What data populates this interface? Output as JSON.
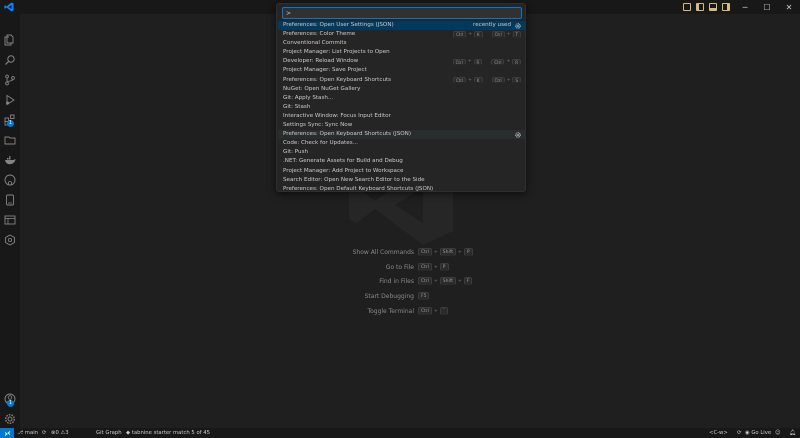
{
  "titlebar": {
    "minimize": "─",
    "maximize": "☐",
    "close": "✕"
  },
  "quickpick": {
    "input_value": ">",
    "items": [
      {
        "label": "Preferences: Open User Settings (JSON)",
        "tag": "recently used",
        "gear": true,
        "state": "active"
      },
      {
        "label": "Preferences: Color Theme",
        "keys": [
          [
            "Ctrl",
            "K"
          ],
          [
            "Ctrl",
            "T"
          ]
        ]
      },
      {
        "label": "Conventional Commits"
      },
      {
        "label": "Project Manager: List Projects to Open"
      },
      {
        "label": "Developer: Reload Window",
        "keys": [
          [
            "Ctrl",
            "R"
          ],
          [
            "Ctrl",
            "R"
          ]
        ]
      },
      {
        "label": "Project Manager: Save Project"
      },
      {
        "label": "Preferences: Open Keyboard Shortcuts",
        "keys": [
          [
            "Ctrl",
            "K"
          ],
          [
            "Ctrl",
            "S"
          ]
        ]
      },
      {
        "label": "NuGet: Open NuGet Gallery"
      },
      {
        "label": "Git: Apply Stash..."
      },
      {
        "label": "Git: Stash"
      },
      {
        "label": "Interactive Window: Focus Input Editor"
      },
      {
        "label": "Settings Sync: Sync Now"
      },
      {
        "label": "Preferences: Open Keyboard Shortcuts (JSON)",
        "gear": true,
        "state": "hover"
      },
      {
        "label": "Code: Check for Updates..."
      },
      {
        "label": "Git: Push"
      },
      {
        "label": ".NET: Generate Assets for Build and Debug"
      },
      {
        "label": "Project Manager: Add Project to Workspace"
      },
      {
        "label": "Search Editor: Open New Search Editor to the Side"
      },
      {
        "label": "Preferences: Open Default Keyboard Shortcuts (JSON)"
      }
    ]
  },
  "shortcuts": [
    {
      "label": "Show All Commands",
      "keys": [
        "Ctrl",
        "Shift",
        "P"
      ]
    },
    {
      "label": "Go to File",
      "keys": [
        "Ctrl",
        "P"
      ]
    },
    {
      "label": "Find in Files",
      "keys": [
        "Ctrl",
        "Shift",
        "F"
      ]
    },
    {
      "label": "Start Debugging",
      "keys": [
        "F5"
      ]
    },
    {
      "label": "Toggle Terminal",
      "keys": [
        "Ctrl",
        "`"
      ]
    }
  ],
  "activitybar": {
    "extensions_badge": "1",
    "accounts_badge": "1"
  },
  "statusbar": {
    "branch": "main",
    "errors": "0",
    "warnings": "3",
    "git_graph": "Git Graph",
    "tabnine": "tabnine starter",
    "match": "match 5 of 45",
    "keybinding": "<C-w>",
    "go_live": "Go Live"
  },
  "colors": {
    "accent": "#0078d4",
    "background": "#1f1f1f",
    "titlebar_icon": "#d7ba7d"
  }
}
